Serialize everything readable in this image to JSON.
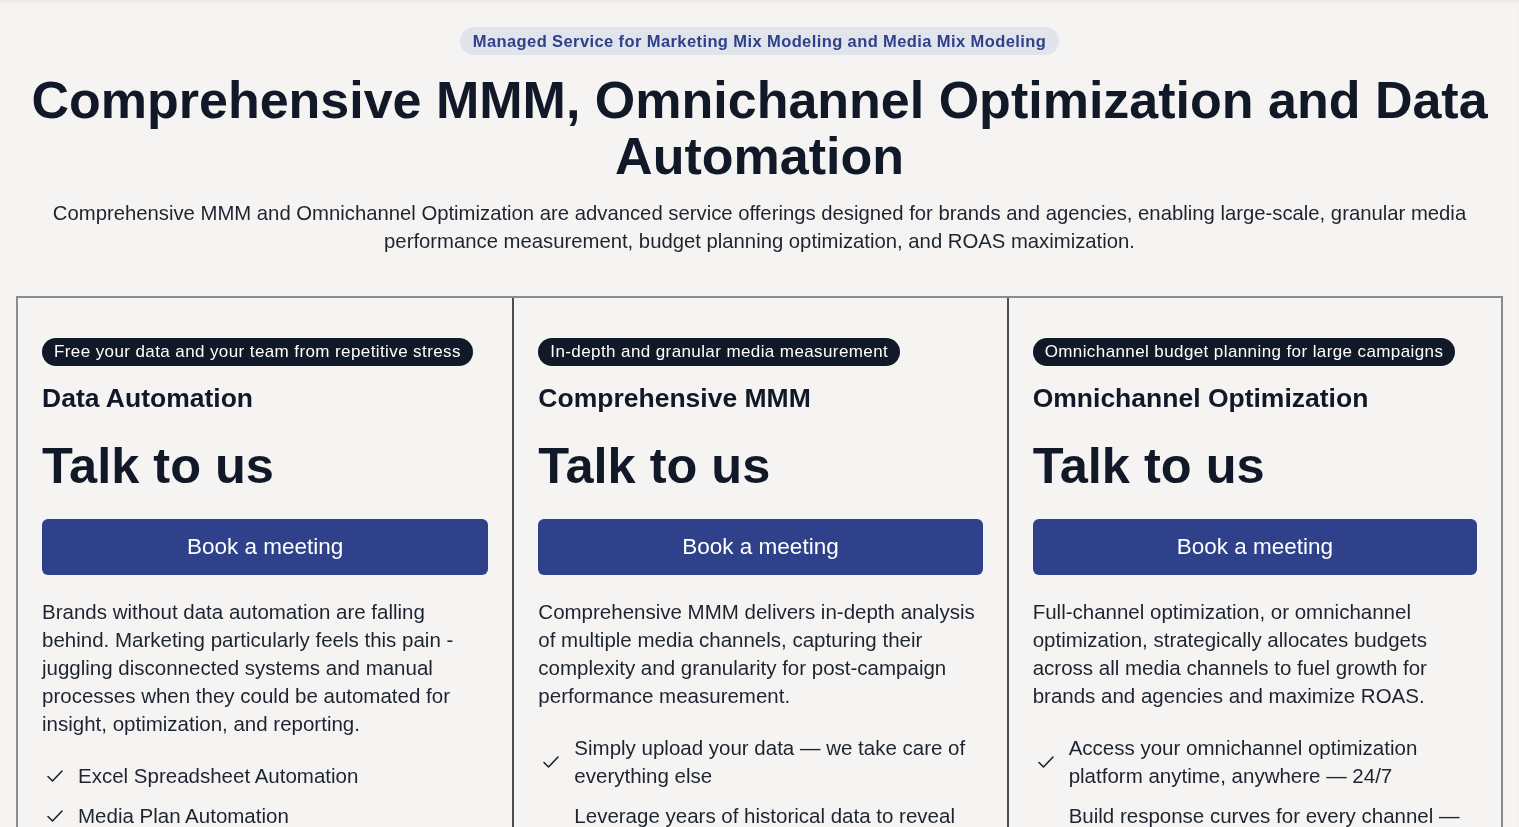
{
  "hero": {
    "eyebrow": "Managed Service for Marketing Mix Modeling and Media Mix Modeling",
    "title": "Comprehensive MMM, Omnichannel Optimization and Data Automation",
    "subtitle": "Comprehensive MMM and Omnichannel Optimization are advanced service offerings designed for brands and agencies, enabling large-scale, granular media performance measurement, budget planning optimization, and ROAS maximization."
  },
  "plans": [
    {
      "tag": "Free your data and your team from repetitive stress",
      "name": "Data Automation",
      "price": "Talk to us",
      "button": "Book a meeting",
      "description": "Brands without data automation are falling behind. Marketing particularly feels this pain - juggling disconnected systems and manual processes when they could be automated for insight, optimization, and reporting.",
      "features": [
        {
          "text": "Excel Spreadsheet Automation",
          "checked": true
        },
        {
          "text": "Media Plan Automation",
          "checked": true
        }
      ]
    },
    {
      "tag": "In-depth and granular media measurement",
      "name": "Comprehensive MMM",
      "price": "Talk to us",
      "button": "Book a meeting",
      "description": "Comprehensive MMM delivers in-depth analysis of multiple media channels, capturing their complexity and granularity for post-campaign performance measurement.",
      "features": [
        {
          "text": "Simply upload your data — we take care of everything else",
          "checked": true
        },
        {
          "text": "Leverage years of historical data to reveal",
          "checked": false
        }
      ]
    },
    {
      "tag": "Omnichannel budget planning for large campaigns",
      "name": "Omnichannel Optimization",
      "price": "Talk to us",
      "button": "Book a meeting",
      "description": "Full-channel optimization, or omnichannel optimization, strategically allocates budgets across all media channels to fuel growth for brands and agencies and maximize ROAS.",
      "features": [
        {
          "text": "Access your omnichannel optimization platform anytime, anywhere — 24/7",
          "checked": true
        },
        {
          "text": "Build response curves for every channel —",
          "checked": false
        }
      ]
    }
  ]
}
